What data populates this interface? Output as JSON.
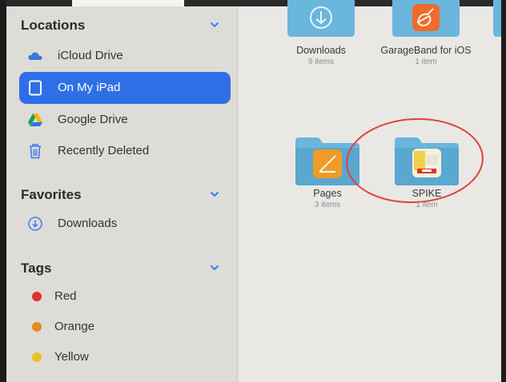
{
  "sidebar": {
    "locations": {
      "title": "Locations",
      "items": [
        {
          "label": "iCloud Drive"
        },
        {
          "label": "On My iPad"
        },
        {
          "label": "Google Drive"
        },
        {
          "label": "Recently Deleted"
        }
      ]
    },
    "favorites": {
      "title": "Favorites",
      "items": [
        {
          "label": "Downloads"
        }
      ]
    },
    "tags": {
      "title": "Tags",
      "items": [
        {
          "label": "Red",
          "color": "#e0342a"
        },
        {
          "label": "Orange",
          "color": "#e68a22"
        },
        {
          "label": "Yellow",
          "color": "#e9c12c"
        }
      ]
    }
  },
  "main": {
    "items": [
      {
        "name": "Downloads",
        "count": "9 items"
      },
      {
        "name": "GarageBand for iOS",
        "count": "1 item"
      },
      {
        "name": "Pages",
        "count": "3 items"
      },
      {
        "name": "SPIKE",
        "count": "1 item"
      }
    ]
  },
  "colors": {
    "accent": "#2f6fe6",
    "folder": "#6ab6dc",
    "annotation": "#e0403a"
  }
}
